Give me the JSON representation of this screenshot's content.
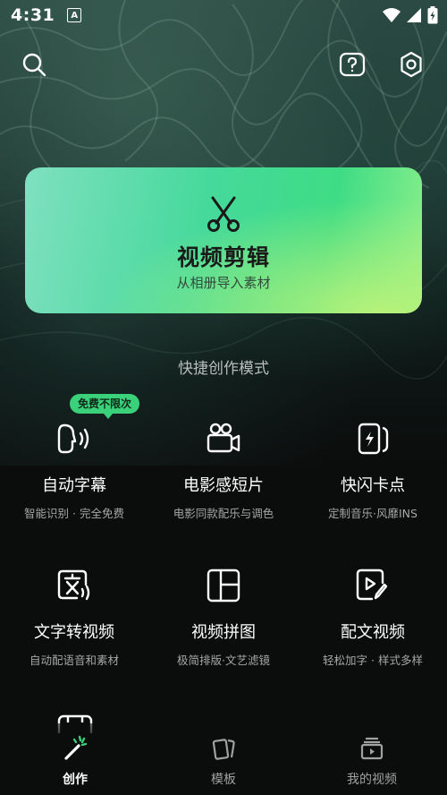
{
  "status_bar": {
    "time": "4:31",
    "notification_letter": "A"
  },
  "hero": {
    "title": "视频剪辑",
    "subtitle": "从相册导入素材"
  },
  "quick_create": {
    "title": "快捷创作模式",
    "badge": "免费不限次",
    "items": [
      {
        "title": "自动字幕",
        "subtitle": "智能识别 · 完全免费",
        "icon": "speech-icon"
      },
      {
        "title": "电影感短片",
        "subtitle": "电影同款配乐与调色",
        "icon": "movie-camera-icon"
      },
      {
        "title": "快闪卡点",
        "subtitle": "定制音乐·风靡INS",
        "icon": "flash-cards-icon"
      },
      {
        "title": "文字转视频",
        "subtitle": "自动配语音和素材",
        "icon": "text-to-video-icon"
      },
      {
        "title": "视频拼图",
        "subtitle": "极简排版·文艺滤镜",
        "icon": "collage-icon"
      },
      {
        "title": "配文视频",
        "subtitle": "轻松加字 · 样式多样",
        "icon": "caption-video-icon"
      }
    ]
  },
  "bottom_nav": {
    "items": [
      {
        "label": "创作",
        "icon": "magic-wand-icon",
        "active": true
      },
      {
        "label": "模板",
        "icon": "template-icon",
        "active": false
      },
      {
        "label": "我的视频",
        "icon": "my-videos-icon",
        "active": false
      }
    ]
  },
  "colors": {
    "accent": "#3ad17a",
    "card_start": "#7fe0c0",
    "card_end": "#8ef08a",
    "background": "#0b0c0c"
  }
}
